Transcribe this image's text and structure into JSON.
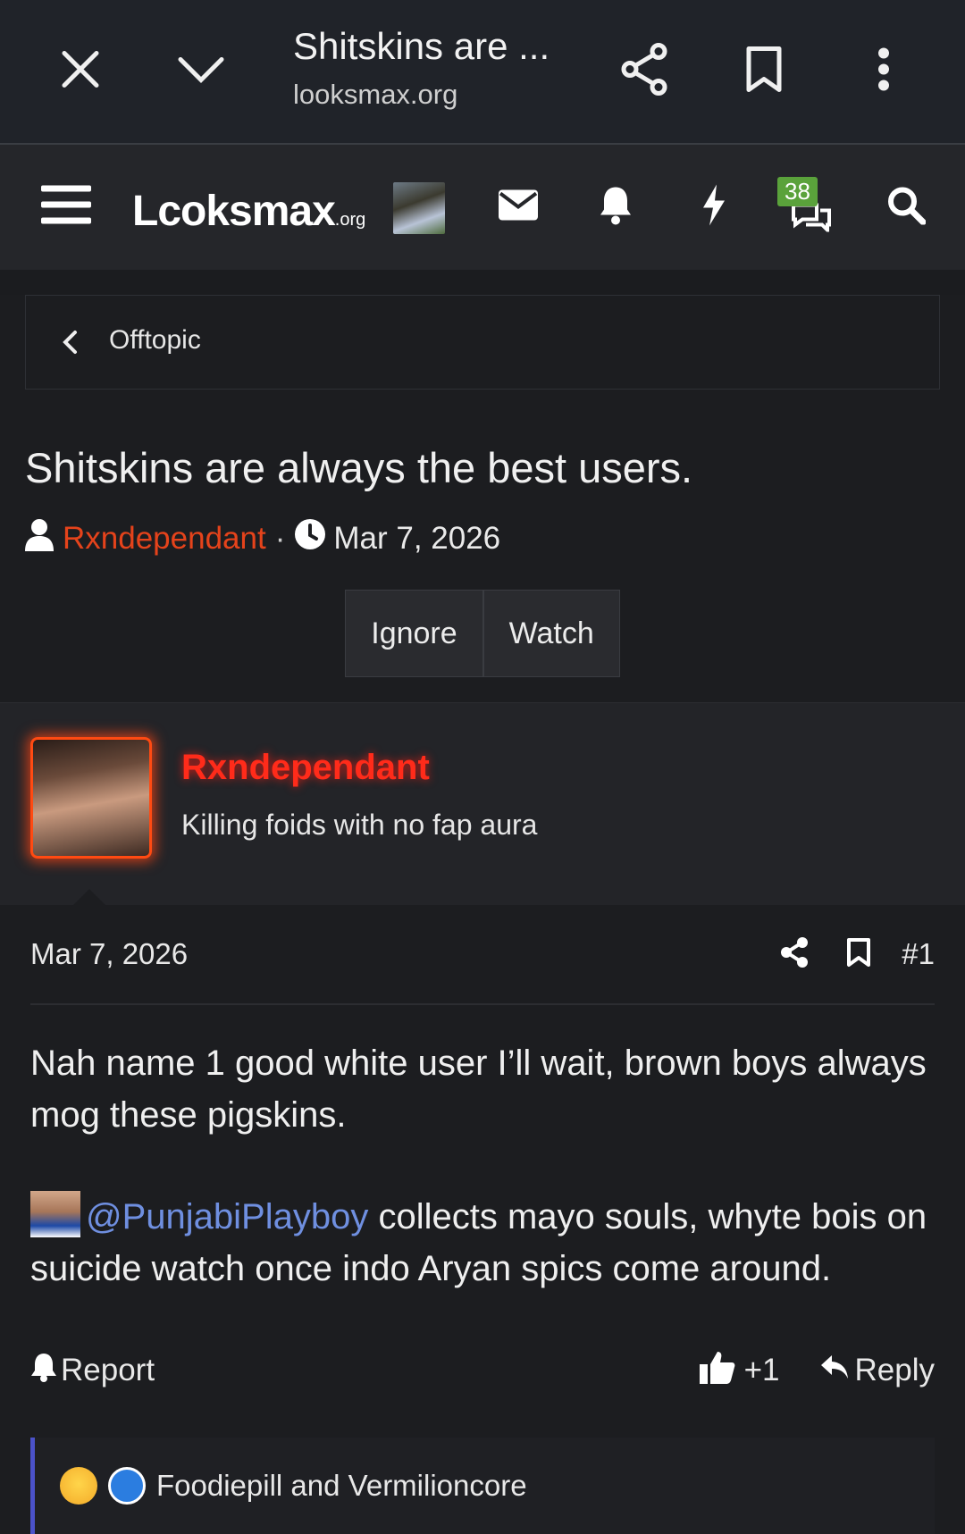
{
  "browser": {
    "title": "Shitskins are ...",
    "url": "looksmax.org"
  },
  "site": {
    "logo_main": "Lcoksmax",
    "logo_suffix": ".org",
    "conversations_badge": "38"
  },
  "breadcrumb": {
    "label": "Offtopic"
  },
  "thread": {
    "title": "Shitskins are always the best users.",
    "author": "Rxndependant",
    "separator": "·",
    "date": "Mar 7, 2026",
    "buttons": {
      "ignore": "Ignore",
      "watch": "Watch"
    }
  },
  "post": {
    "username": "Rxndependant",
    "user_title": "Killing foids with no fap aura",
    "date": "Mar 7, 2026",
    "number": "#1",
    "paragraph1": "Nah name 1 good white user I’ll wait, brown boys always mog these pigskins.",
    "mention": "@PunjabiPlayboy",
    "paragraph2_rest": " collects mayo souls, whyte bois on suicide watch once indo Aryan spics come around.",
    "report_label": "Report",
    "reaction_count": "+1",
    "reply_label": "Reply",
    "reactions_by": "Foodiepill and Vermilioncore"
  },
  "colors": {
    "accent_author": "#e5431b",
    "username_glow": "#ff2b1a",
    "mention": "#6f8fe0",
    "badge": "#5aa23b",
    "reaction_bar": "#4b52c9"
  }
}
